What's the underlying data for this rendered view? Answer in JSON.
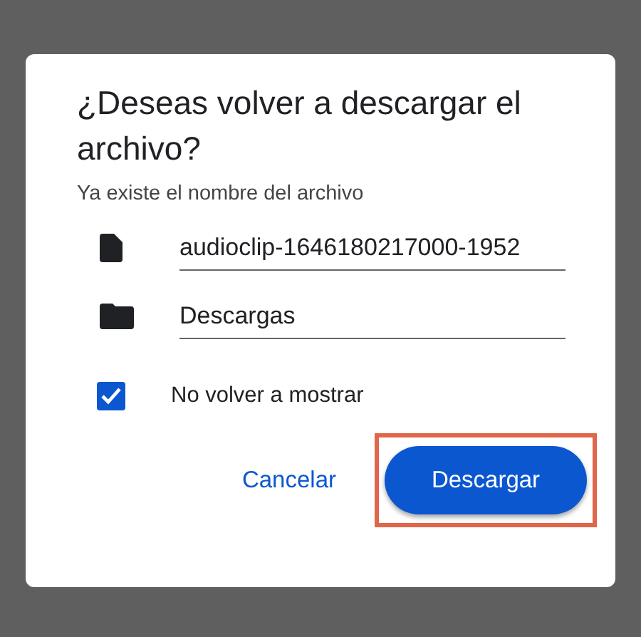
{
  "dialog": {
    "title": "¿Deseas volver a descargar el archivo?",
    "subtitle": "Ya existe el nombre del archivo",
    "fields": [
      {
        "kind": "file",
        "value": "audioclip-1646180217000-1952"
      },
      {
        "kind": "folder",
        "value": "Descargas"
      }
    ],
    "checkbox": {
      "label": "No volver a mostrar",
      "checked": true
    },
    "buttons": [
      {
        "kind": "text",
        "label": "Cancelar",
        "highlighted": false
      },
      {
        "kind": "filled",
        "label": "Descargar",
        "highlighted": true
      }
    ]
  }
}
